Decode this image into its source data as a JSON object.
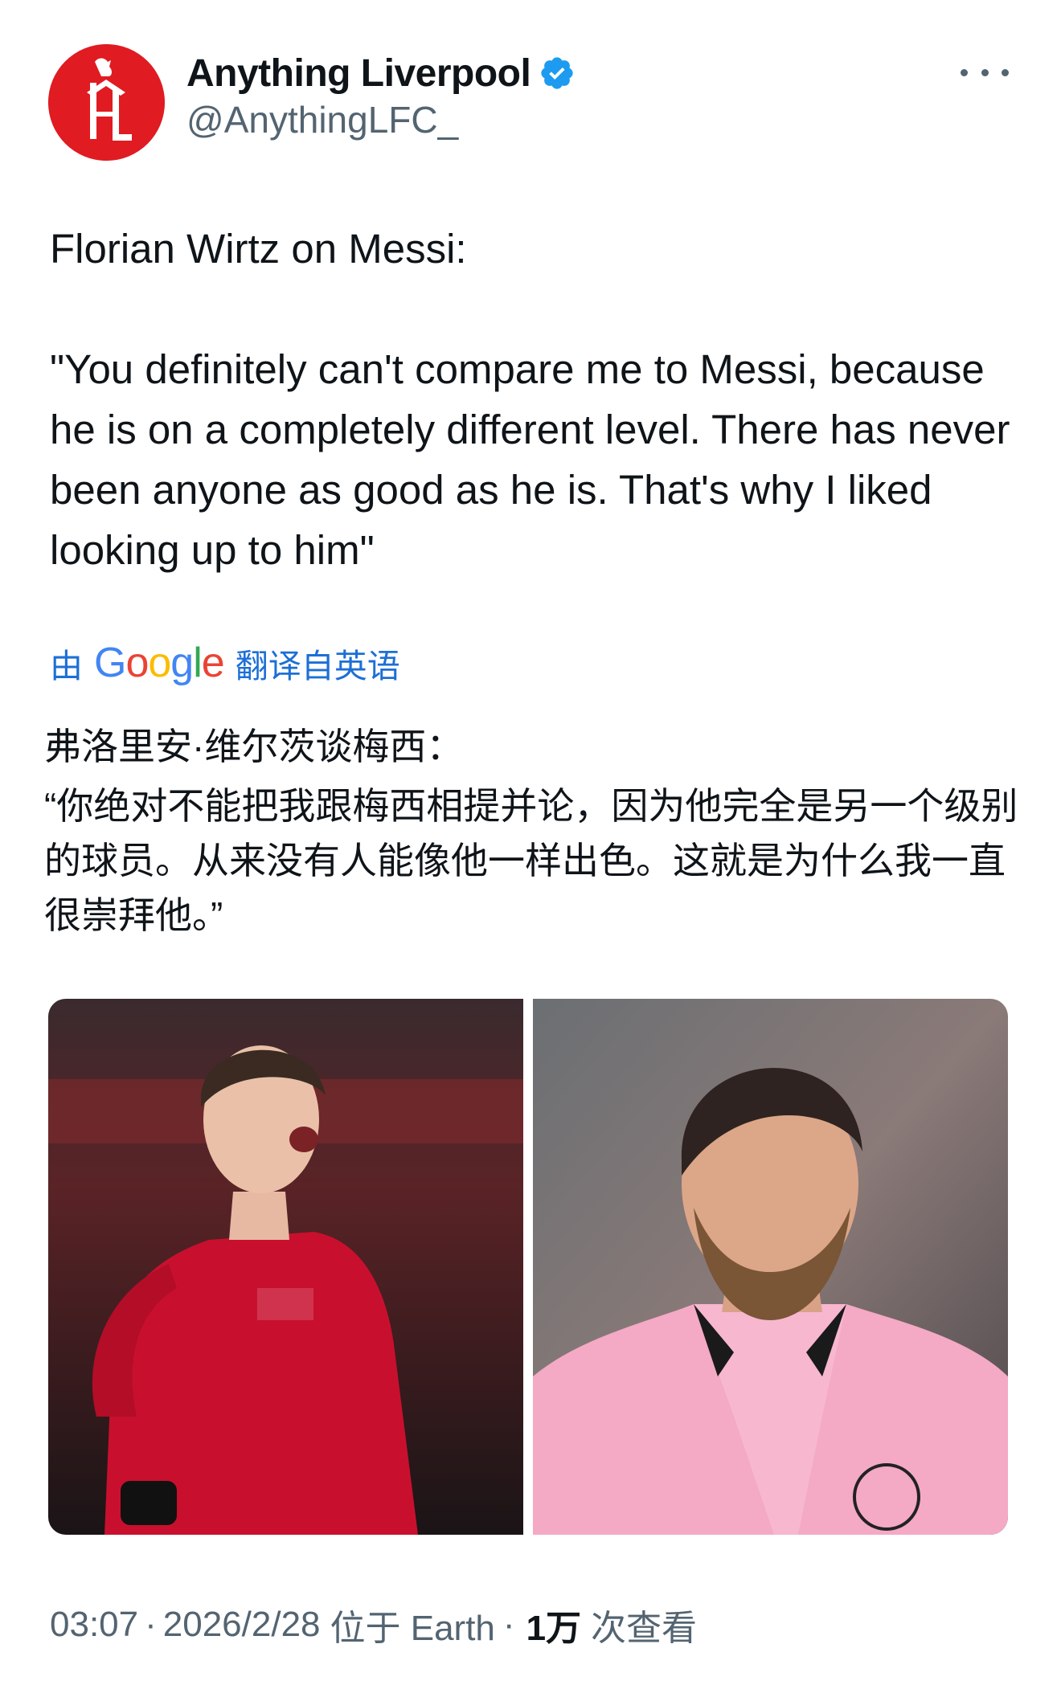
{
  "author": {
    "display_name": "Anything Liverpool",
    "handle": "@AnythingLFC_",
    "avatar_text": "AL"
  },
  "tweet": {
    "text": "Florian Wirtz on Messi:\n\n\"You definitely can't compare me to Messi, because he is on a completely different level. There has never been anyone as good as he is. That's why I liked looking up to him\""
  },
  "translation": {
    "by_label": "由",
    "provider": "Google",
    "from_label": "翻译自英语",
    "line1": "弗洛里安·维尔茨谈梅西：",
    "line2": "“你绝对不能把我跟梅西相提并论，因为他完全是另一个级别的球员。从来没有人能像他一样出色。这就是为什么我一直很崇拜他。”"
  },
  "meta": {
    "time": "03:07",
    "sep1": "·",
    "date": "2026/2/28",
    "location": "位于 Earth",
    "sep2": "·",
    "views_count": "1万",
    "views_label": "次查看"
  },
  "colors": {
    "brand_red": "#e01b22",
    "verified_blue": "#1d9bf0",
    "translate_blue": "#1d6fd6",
    "secondary_text": "#536471"
  }
}
